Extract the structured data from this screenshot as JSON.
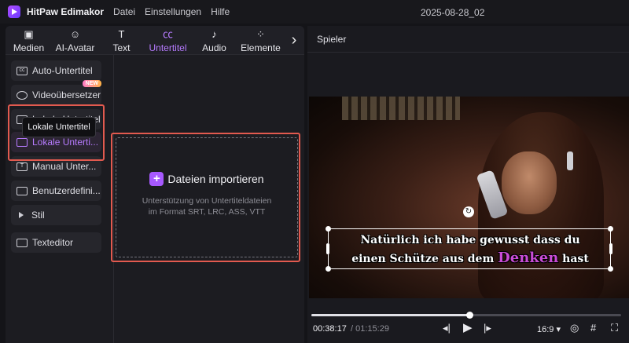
{
  "titlebar": {
    "app_name": "HitPaw Edimakor",
    "menu": [
      "Datei",
      "Einstellungen",
      "Hilfe"
    ],
    "project_title": "2025-08-28_02"
  },
  "tabs": [
    {
      "label": "Medien",
      "icon": "media-icon",
      "active": false
    },
    {
      "label": "AI-Avatar",
      "icon": "avatar-icon",
      "active": false
    },
    {
      "label": "Text",
      "icon": "text-icon",
      "active": false
    },
    {
      "label": "Untertitel",
      "icon": "subtitle-icon",
      "active": true
    },
    {
      "label": "Audio",
      "icon": "music-note-icon",
      "active": false
    },
    {
      "label": "Elemente",
      "icon": "elements-icon",
      "active": false
    }
  ],
  "sidebar": {
    "items": [
      {
        "label": "Auto-Untertitel",
        "icon": "cc-icon"
      },
      {
        "label": "Videoübersetzer",
        "icon": "translate-icon",
        "badge": "NEW"
      },
      {
        "label": "Lokale Untertitel",
        "icon": "caption-icon"
      },
      {
        "label": "Lokale Unterti...",
        "icon": "subtitle-file-icon",
        "active": true
      },
      {
        "label": "Manual Unter...",
        "icon": "manual-subtitle-icon"
      },
      {
        "label": "Benutzerdefini...",
        "icon": "custom-icon"
      },
      {
        "label": "Stil",
        "icon": "triangle-icon"
      },
      {
        "label": "Texteditor",
        "icon": "text-editor-icon"
      }
    ],
    "tooltip": "Lokale Untertitel"
  },
  "import": {
    "button_label": "Dateien importieren",
    "description_line1": "Unterstützung von Untertiteldateien",
    "description_line2": "im Format SRT, LRC, ASS, VTT"
  },
  "player": {
    "header": "Spieler",
    "subtitle_line1": "Natürlich ich habe gewusst dass du",
    "subtitle_line2_pre": "einen Schütze aus dem ",
    "subtitle_line2_highlight": "Denken",
    "subtitle_line2_post": " hast",
    "time_current": "00:38:17",
    "time_total": "/ 01:15:29",
    "progress": 0.51,
    "aspect_ratio": "16:9 ▾"
  },
  "colors": {
    "accent": "#b77bff",
    "highlight_frame": "#e25a4f",
    "subtitle_highlight": "#c94cd6"
  }
}
